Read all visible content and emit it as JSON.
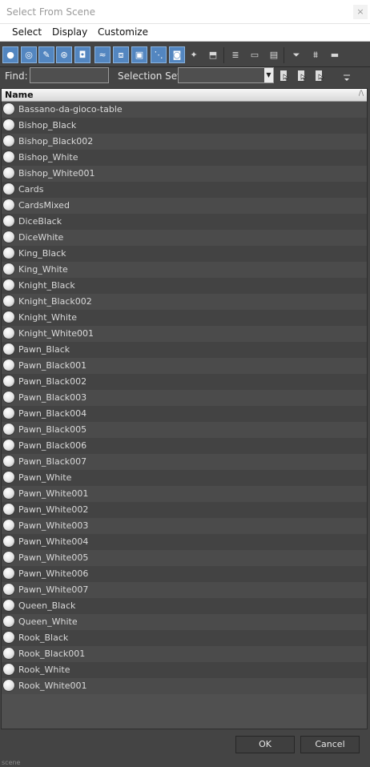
{
  "window": {
    "title": "Select From Scene",
    "close_glyph": "×"
  },
  "menu": [
    "Select",
    "Display",
    "Customize"
  ],
  "toolbar": {
    "buttons": [
      {
        "name": "display-geometry-icon",
        "on": true
      },
      {
        "name": "display-shapes-icon",
        "on": true
      },
      {
        "name": "display-lights-icon",
        "on": true
      },
      {
        "name": "display-cameras-icon",
        "on": true
      },
      {
        "name": "display-helpers-icon",
        "on": true
      },
      {
        "name": "display-spacewarps-icon",
        "on": true
      },
      {
        "name": "display-groups-icon",
        "on": true
      },
      {
        "name": "display-xrefs-icon",
        "on": true
      },
      {
        "name": "display-bones-icon",
        "on": true
      },
      {
        "name": "display-containers-icon",
        "on": true
      },
      {
        "name": "display-frozen-icon",
        "on": false
      },
      {
        "name": "display-hidden-icon",
        "on": false
      },
      {
        "name": "column-list-icon",
        "on": false
      },
      {
        "name": "column-white-icon",
        "on": false
      },
      {
        "name": "column-doc-icon",
        "on": false
      },
      {
        "name": "filter-icon",
        "on": false
      },
      {
        "name": "filter-options-icon",
        "on": false
      },
      {
        "name": "layer-icon",
        "on": false
      }
    ]
  },
  "find": {
    "label": "Find:",
    "value": ""
  },
  "selection_set": {
    "label": "Selection Set:",
    "value": ""
  },
  "list": {
    "header": "Name",
    "items": [
      "Bassano-da-gioco-table",
      "Bishop_Black",
      "Bishop_Black002",
      "Bishop_White",
      "Bishop_White001",
      "Cards",
      "CardsMixed",
      "DiceBlack",
      "DiceWhite",
      "King_Black",
      "King_White",
      "Knight_Black",
      "Knight_Black002",
      "Knight_White",
      "Knight_White001",
      "Pawn_Black",
      "Pawn_Black001",
      "Pawn_Black002",
      "Pawn_Black003",
      "Pawn_Black004",
      "Pawn_Black005",
      "Pawn_Black006",
      "Pawn_Black007",
      "Pawn_White",
      "Pawn_White001",
      "Pawn_White002",
      "Pawn_White003",
      "Pawn_White004",
      "Pawn_White005",
      "Pawn_White006",
      "Pawn_White007",
      "Queen_Black",
      "Queen_White",
      "Rook_Black",
      "Rook_Black001",
      "Rook_White",
      "Rook_White001"
    ]
  },
  "footer": {
    "ok": "OK",
    "cancel": "Cancel",
    "grip_text": "scene"
  }
}
